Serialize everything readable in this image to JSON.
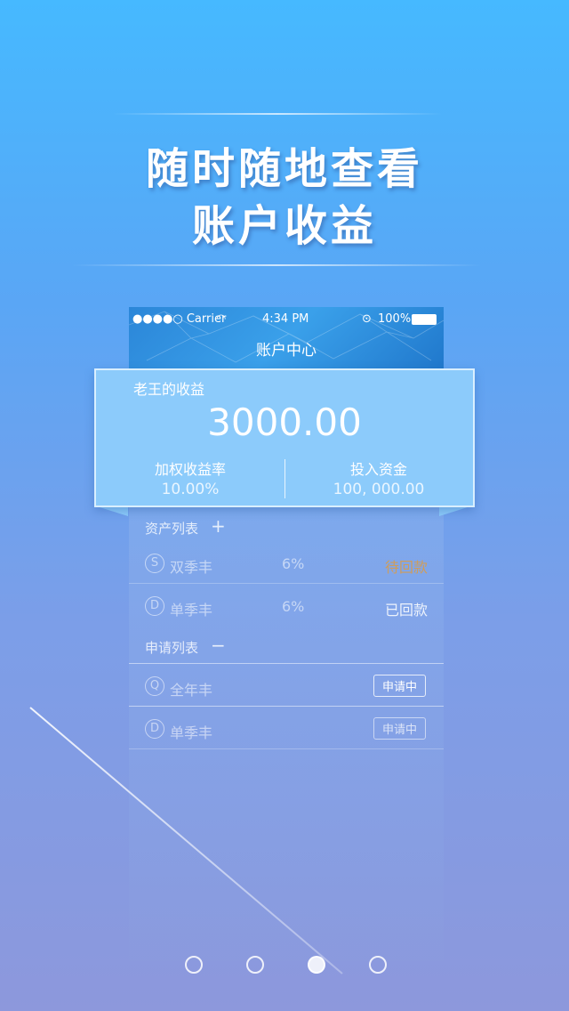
{
  "headline": {
    "line1": "随时随地查看",
    "line2": "账户收益"
  },
  "status_bar": {
    "carrier": "●●●●○ Carrier",
    "time": "4:34 PM",
    "battery": "100%"
  },
  "nav": {
    "title": "账户中心"
  },
  "card": {
    "owner_label": "老王的收益",
    "amount": "3000.00",
    "rate_label": "加权收益率",
    "rate_value": "10.00%",
    "capital_label": "投入资金",
    "capital_value": "100, 000.00"
  },
  "assets": {
    "title": "资产列表",
    "toggle": "+",
    "items": [
      {
        "icon": "S",
        "name": "双季丰",
        "rate": "6%",
        "status": "待回款"
      },
      {
        "icon": "D",
        "name": "单季丰",
        "rate": "6%",
        "status": "已回款"
      }
    ]
  },
  "applications": {
    "title": "申请列表",
    "toggle": "−",
    "items": [
      {
        "icon": "Q",
        "name": "全年丰",
        "status": "申请中"
      },
      {
        "icon": "D",
        "name": "单季丰",
        "status": "申请中"
      }
    ]
  },
  "pager": {
    "count": 4,
    "active_index": 2
  },
  "colors": {
    "accent": "#8ccbfb",
    "pending_status": "#e89a2c"
  }
}
